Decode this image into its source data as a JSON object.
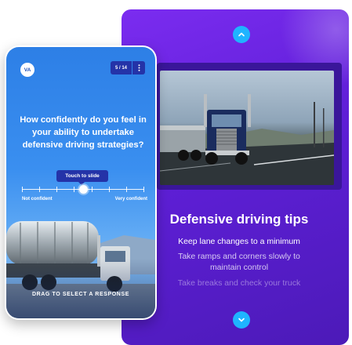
{
  "colors": {
    "panel": "#6224e0",
    "accent": "#1fb4ff",
    "phone_button": "#2433a8",
    "phone_bg": "#3a8ff0"
  },
  "phone": {
    "logo": "VA",
    "counter": "5 / 14",
    "menu_icon": "vertical-ellipsis-icon",
    "question": "How confidently do you feel in your ability to undertake defensive driving strategies?",
    "slider": {
      "pill": "Touch to slide",
      "left_label": "Not confident",
      "right_label": "Very confident",
      "value": 0.5
    },
    "drag_hint": "DRAG TO SELECT A RESPONSE"
  },
  "panel": {
    "title": "Defensive driving tips",
    "tips": [
      "Keep lane changes to a minimum",
      "Take ramps and corners slowly to maintain control",
      "Take breaks and check your truck"
    ],
    "up_icon": "chevron-up-icon",
    "down_icon": "chevron-down-icon"
  }
}
